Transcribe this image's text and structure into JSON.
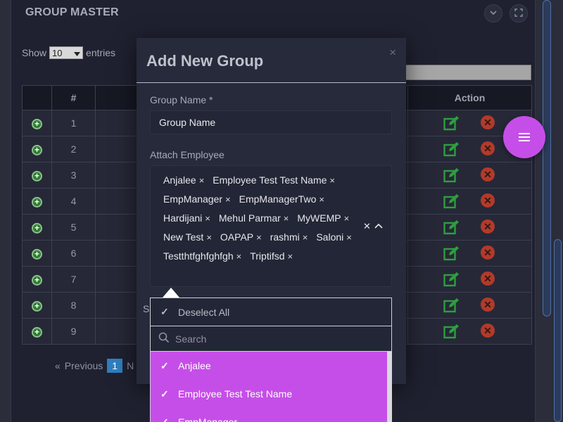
{
  "page": {
    "title": "GROUP MASTER",
    "show_label": "Show",
    "entries_value": "10",
    "entries_label": "entries",
    "table_headers": {
      "num": "#",
      "action": "Action"
    },
    "rows": [
      "1",
      "2",
      "3",
      "4",
      "5",
      "6",
      "7",
      "8",
      "9"
    ],
    "pagination": {
      "prev_arrow": "«",
      "prev": "Previous",
      "active": "1",
      "next_partial": "N"
    }
  },
  "modal": {
    "title": "Add New Group",
    "close": "×",
    "group_name_label": "Group Name *",
    "group_name_value": "Group Name",
    "attach_label": "Attach Employee",
    "selected_employees": [
      "Anjalee",
      "Employee Test Test Name",
      "EmpManager",
      "EmpManagerTwo",
      "Hardijani",
      "Mehul Parmar",
      "MyWEMP",
      "New Test",
      "OAPAP",
      "rashmi",
      "Saloni",
      "Testthtfghfghfgh",
      "Triptifsd"
    ],
    "chip_remove": "×",
    "partial_label": "S"
  },
  "dropdown": {
    "deselect_all": "Deselect All",
    "search_placeholder": "Search",
    "options": [
      "Anjalee",
      "Employee Test Test Name",
      "EmpManager"
    ],
    "highlight_color": "#c64ee8"
  },
  "colors": {
    "fab": "#c64ee8",
    "edit_icon": "#2e9e3e",
    "delete_icon": "#b23a2a",
    "active_page": "#2f7fbf"
  }
}
